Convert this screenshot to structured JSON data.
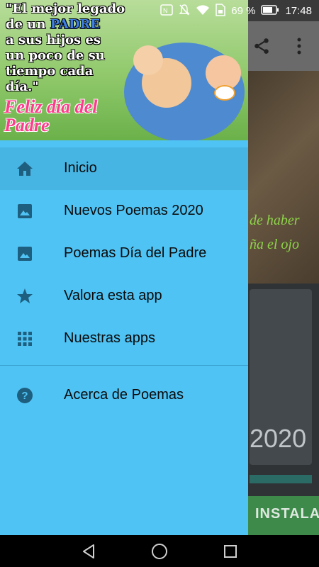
{
  "status_bar": {
    "battery_percent": "69 %",
    "time": "17:48",
    "icons": [
      "nfc-icon",
      "mute-icon",
      "wifi-icon",
      "sim-icon",
      "battery-icon"
    ]
  },
  "background": {
    "image_text_line1": "de haber",
    "image_text_line2": "ña el ojo",
    "card_year": "2020",
    "install_label": "INSTALA"
  },
  "drawer": {
    "header": {
      "quote_lines": [
        "\"El mejor legado",
        "de un ",
        "a sus hijos es",
        "un poco de su",
        "tiempo cada",
        "día.\""
      ],
      "quote_highlight": "PADRE",
      "greeting_line1": "Feliz día del",
      "greeting_line2": "Padre"
    },
    "items": [
      {
        "label": "Inicio",
        "icon": "home-icon",
        "active": true
      },
      {
        "label": "Nuevos Poemas 2020",
        "icon": "image-icon",
        "active": false
      },
      {
        "label": "Poemas Día del Padre",
        "icon": "image-icon",
        "active": false
      },
      {
        "label": "Valora esta app",
        "icon": "star-icon",
        "active": false
      },
      {
        "label": "Nuestras apps",
        "icon": "apps-grid-icon",
        "active": false
      }
    ],
    "secondary_items": [
      {
        "label": "Acerca de Poemas",
        "icon": "help-icon"
      }
    ]
  },
  "colors": {
    "drawer_bg": "#4fc3f4",
    "active_item_bg": "#47b5e3",
    "icon_color": "#1e5f7f"
  }
}
